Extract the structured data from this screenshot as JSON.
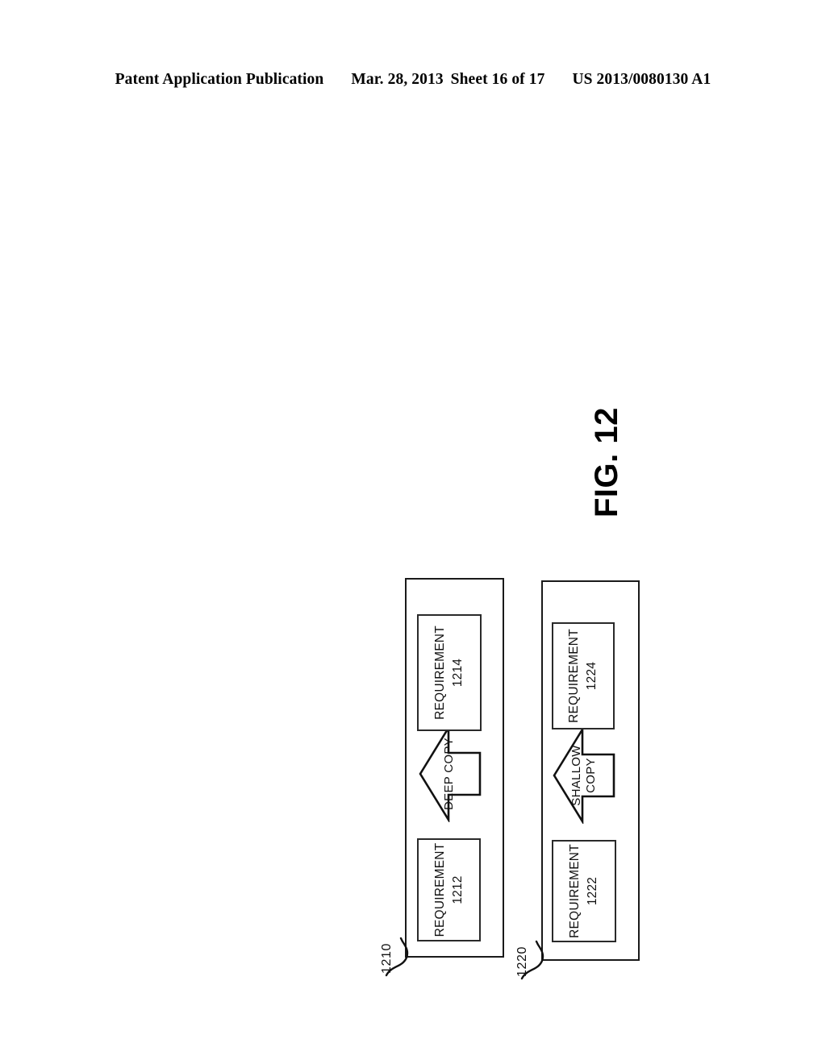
{
  "header": {
    "publication": "Patent Application Publication",
    "date": "Mar. 28, 2013",
    "sheet": "Sheet 16 of 17",
    "pub_number": "US 2013/0080130 A1"
  },
  "figure": {
    "caption": "FIG. 12",
    "groups": [
      {
        "id": "1210",
        "ref_label": "1210",
        "type": "deep-copy-group",
        "source_box": {
          "title": "REQUIREMENT",
          "number": "1212"
        },
        "arrow": {
          "label_line1": "DEEP COPY",
          "label_line2": "",
          "direction": "up"
        },
        "target_box": {
          "title": "REQUIREMENT",
          "number": "1214"
        }
      },
      {
        "id": "1220",
        "ref_label": "1220",
        "type": "shallow-copy-group",
        "source_box": {
          "title": "REQUIREMENT",
          "number": "1222"
        },
        "arrow": {
          "label_line1": "SHALLOW",
          "label_line2": "COPY",
          "direction": "up"
        },
        "target_box": {
          "title": "REQUIREMENT",
          "number": "1224"
        }
      }
    ]
  },
  "colors": {
    "ink": "#111111",
    "line": "#1a1a1a",
    "paper": "#ffffff"
  }
}
